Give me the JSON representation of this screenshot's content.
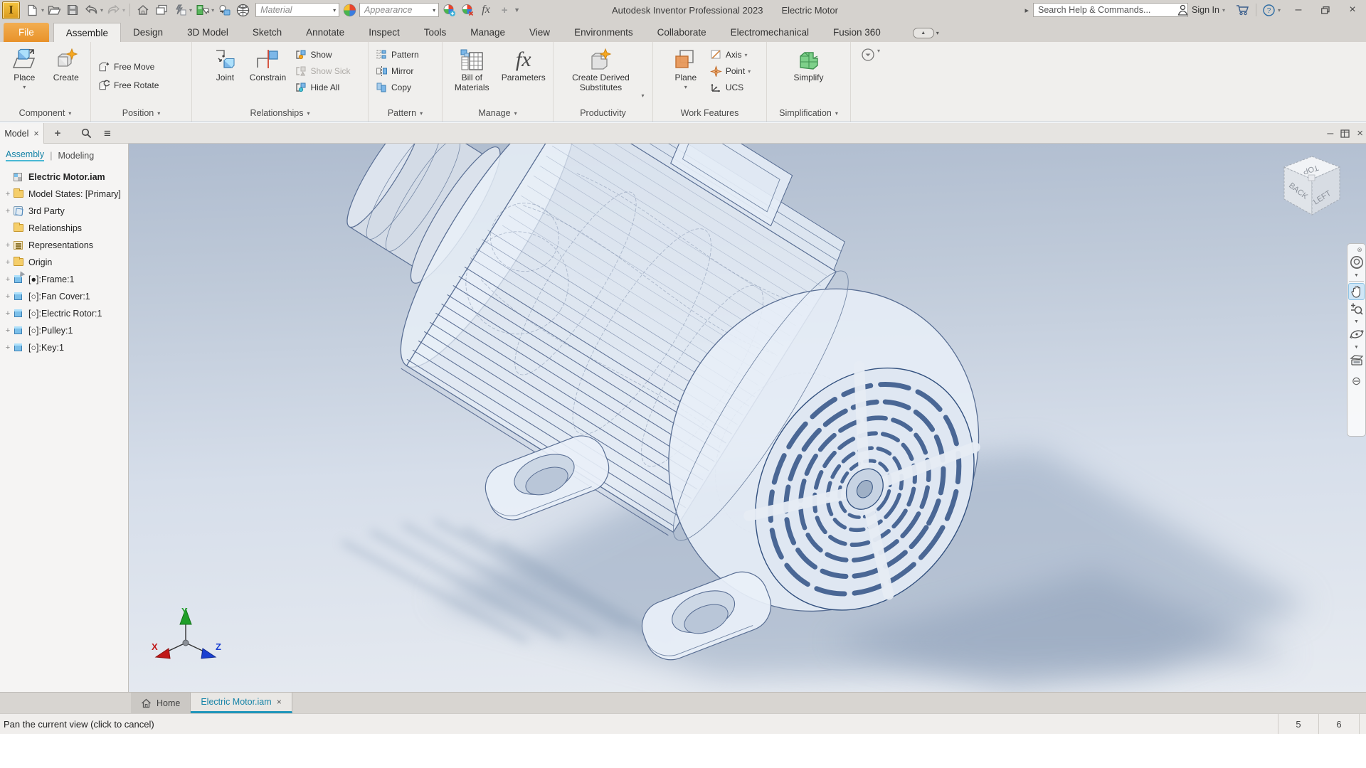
{
  "titlebar": {
    "app_title": "Autodesk Inventor Professional 2023",
    "doc_title": "Electric Motor",
    "search_placeholder": "Search Help & Commands...",
    "sign_in_label": "Sign In",
    "material_combo_value": "Material",
    "appearance_combo_value": "Appearance"
  },
  "icons": {
    "dropdown": "▾",
    "run_arrow": "▸",
    "close": "×",
    "plus": "+",
    "menu": "≡",
    "minimize": "–"
  },
  "ribbon": {
    "tabs": [
      "File",
      "Assemble",
      "Design",
      "3D Model",
      "Sketch",
      "Annotate",
      "Inspect",
      "Tools",
      "Manage",
      "View",
      "Environments",
      "Collaborate",
      "Electromechanical",
      "Fusion 360"
    ],
    "active_tab": "Assemble",
    "panels": [
      {
        "label": "Component",
        "buttons": [
          "Place",
          "Create"
        ]
      },
      {
        "label": "Position",
        "buttons": [
          "Free Move",
          "Free Rotate"
        ]
      },
      {
        "label": "Relationships",
        "buttons": [
          "Joint",
          "Constrain"
        ],
        "smalls": [
          "Show",
          "Show Sick",
          "Hide All"
        ]
      },
      {
        "label": "Pattern",
        "smalls": [
          "Pattern",
          "Mirror",
          "Copy"
        ]
      },
      {
        "label": "Manage",
        "buttons": [
          "Bill of Materials",
          "Parameters"
        ]
      },
      {
        "label": "Productivity",
        "buttons": [
          "Create Derived Substitutes"
        ]
      },
      {
        "label": "Work Features",
        "buttons": [
          "Plane"
        ],
        "smalls": [
          "Axis",
          "Point",
          "UCS"
        ]
      },
      {
        "label": "Simplification",
        "buttons": [
          "Simplify"
        ]
      }
    ]
  },
  "browser": {
    "panel_tab": "Model",
    "tabs": {
      "assembly": "Assembly",
      "separator": "|",
      "modeling": "Modeling"
    },
    "tree": [
      {
        "label": "Electric Motor.iam",
        "icon": "assembly-root",
        "expandable": false
      },
      {
        "label": "Model States: [Primary]",
        "icon": "folder",
        "expandable": true
      },
      {
        "label": "3rd Party",
        "icon": "third-party",
        "expandable": true
      },
      {
        "label": "Relationships",
        "icon": "folder",
        "expandable": false
      },
      {
        "label": "Representations",
        "icon": "representations",
        "expandable": true
      },
      {
        "label": "Origin",
        "icon": "folder",
        "expandable": true
      },
      {
        "label": "[●]:Frame:1",
        "icon": "grounded-part",
        "expandable": true
      },
      {
        "label": "[○]:Fan Cover:1",
        "icon": "part",
        "expandable": true
      },
      {
        "label": "[○]:Electric Rotor:1",
        "icon": "part",
        "expandable": true
      },
      {
        "label": "[○]:Pulley:1",
        "icon": "part",
        "expandable": true
      },
      {
        "label": "[○]:Key:1",
        "icon": "part",
        "expandable": true
      }
    ]
  },
  "viewport": {
    "viewcube": {
      "top": "TOP",
      "back": "BACK",
      "left": "LEFT"
    },
    "triad": {
      "x": "X",
      "y": "Y",
      "z": "Z"
    },
    "model_name": "Electric Motor wireframe 3D view"
  },
  "doctabs": {
    "home": "Home",
    "active_doc": "Electric Motor.iam"
  },
  "statusbar": {
    "message": "Pan the current view (click to cancel)",
    "cells": [
      "5",
      "6"
    ]
  },
  "colors": {
    "file_tab_orange": "#e8922a",
    "accent_teal": "#1583a7",
    "viewport_top": "#afbcce",
    "viewport_bottom": "#e7ebf1",
    "wireframe_stroke": "#4a5f87"
  }
}
